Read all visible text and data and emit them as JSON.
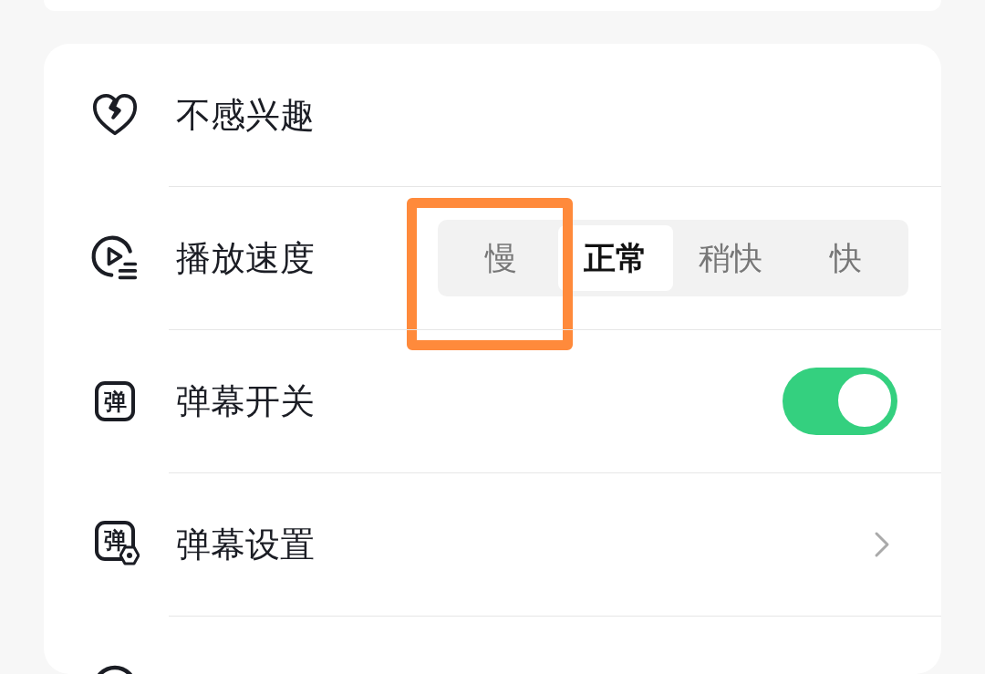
{
  "menu": {
    "rows": [
      {
        "kind": "plain",
        "label": "不感兴趣"
      },
      {
        "kind": "segmented",
        "label": "播放速度",
        "options": [
          {
            "label": "慢",
            "selected": false,
            "highlighted": true
          },
          {
            "label": "正常",
            "selected": true,
            "highlighted": false
          },
          {
            "label": "稍快",
            "selected": false,
            "highlighted": false
          },
          {
            "label": "快",
            "selected": false,
            "highlighted": false
          }
        ]
      },
      {
        "kind": "toggle",
        "icon_text": "弹",
        "label": "弹幕开关",
        "on": true
      },
      {
        "kind": "link",
        "icon_text": "弹",
        "label": "弹幕设置"
      },
      {
        "kind": "cut"
      }
    ]
  }
}
